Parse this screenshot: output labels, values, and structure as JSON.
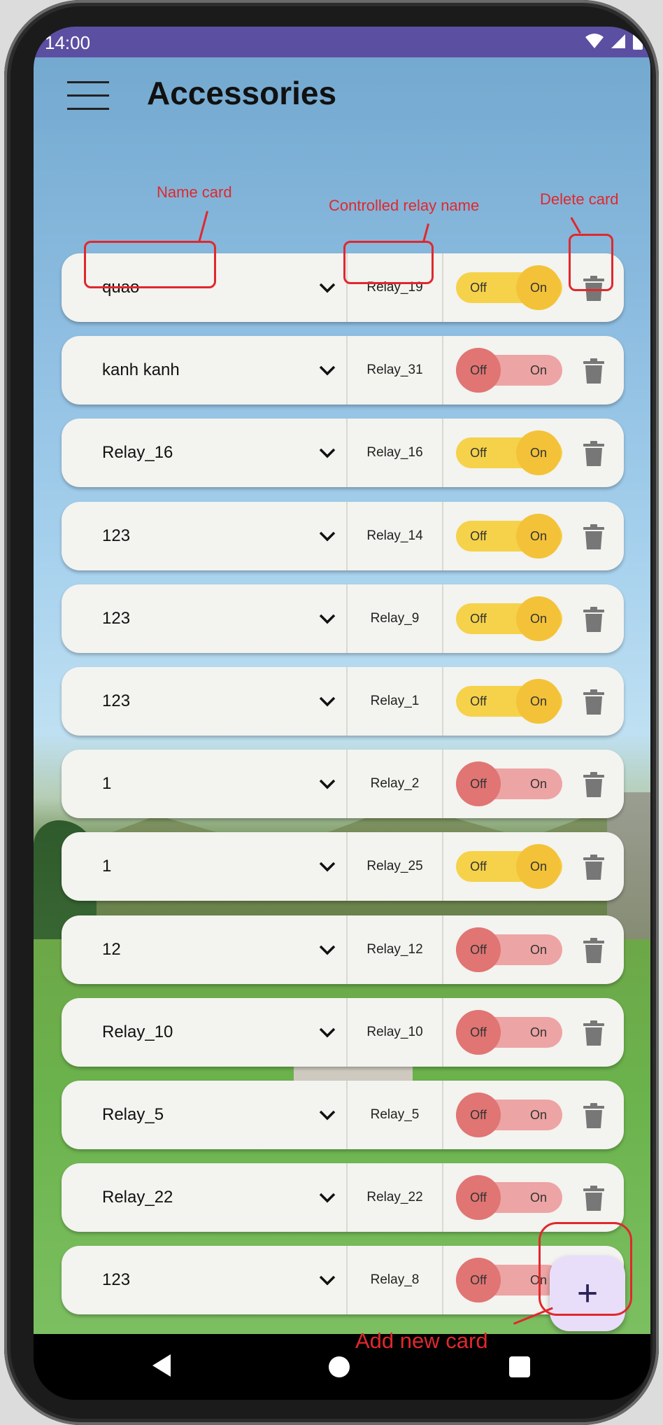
{
  "status_bar": {
    "time": "14:00"
  },
  "app_bar": {
    "title": "Accessories",
    "menu_icon": "hamburger-menu-icon"
  },
  "toggle_labels": {
    "off": "Off",
    "on": "On"
  },
  "colors": {
    "status_bar": "#5b4fa2",
    "toggle_on": "#f5d24a",
    "toggle_on_knob": "#f3c238",
    "toggle_off": "#eda4a4",
    "toggle_off_knob": "#e07573",
    "fab": "#e9defa",
    "annotation": "#e0282d"
  },
  "cards": [
    {
      "name": "quao",
      "relay": "Relay_19",
      "state": "on"
    },
    {
      "name": "kanh kanh",
      "relay": "Relay_31",
      "state": "off"
    },
    {
      "name": "Relay_16",
      "relay": "Relay_16",
      "state": "on"
    },
    {
      "name": "123",
      "relay": "Relay_14",
      "state": "on"
    },
    {
      "name": "123",
      "relay": "Relay_9",
      "state": "on"
    },
    {
      "name": "123",
      "relay": "Relay_1",
      "state": "on"
    },
    {
      "name": "1",
      "relay": "Relay_2",
      "state": "off"
    },
    {
      "name": "1",
      "relay": "Relay_25",
      "state": "on"
    },
    {
      "name": "12",
      "relay": "Relay_12",
      "state": "off"
    },
    {
      "name": "Relay_10",
      "relay": "Relay_10",
      "state": "off"
    },
    {
      "name": "Relay_5",
      "relay": "Relay_5",
      "state": "off"
    },
    {
      "name": "Relay_22",
      "relay": "Relay_22",
      "state": "off"
    },
    {
      "name": "123",
      "relay": "Relay_8",
      "state": "off"
    }
  ],
  "fab": {
    "label": "+"
  },
  "annotations": {
    "name_card": "Name card",
    "relay_name": "Controlled relay name",
    "delete_card": "Delete card",
    "add_card": "Add new card"
  }
}
